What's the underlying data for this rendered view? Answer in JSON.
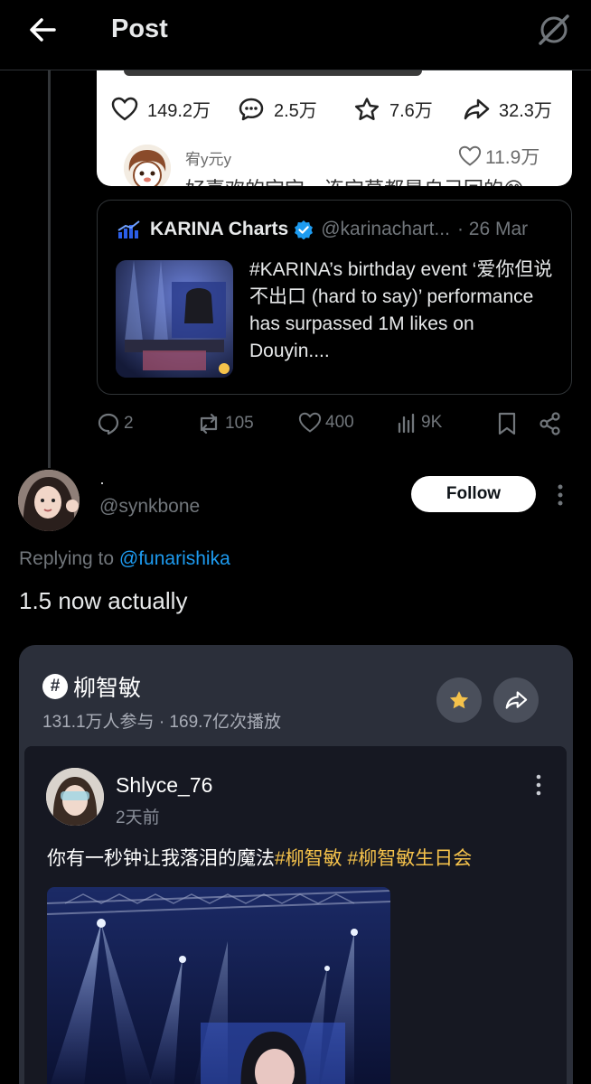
{
  "header": {
    "title": "Post",
    "back_icon": "arrow-left-icon",
    "grok_icon": "grok-icon"
  },
  "embedded_douyin_card": {
    "stats": [
      {
        "icon": "heart-icon",
        "value": "149.2万"
      },
      {
        "icon": "comment-icon",
        "value": "2.5万"
      },
      {
        "icon": "star-icon",
        "value": "7.6万"
      },
      {
        "icon": "share-icon",
        "value": "32.3万"
      }
    ],
    "comment_user": "宥y元y",
    "comment_likes": "11.9万",
    "comment_cut_text": "好喜欢的宝宝，连宝草都是自己回的😊"
  },
  "quote": {
    "name": "KARINA Charts",
    "handle": "@karinachart...",
    "date": "· 26 Mar",
    "text": "#KARINA’s birthday event ‘爱你但说不出口 (hard to say)’ performance has surpassed 1M likes on Douyin...."
  },
  "actions": {
    "replies": "2",
    "reposts": "105",
    "likes": "400",
    "views": "9K"
  },
  "reply": {
    "display_name": "·",
    "handle": "@synkbone",
    "follow_label": "Follow",
    "replying_prefix": "Replying to ",
    "replying_to": "@funarishika",
    "text": "1.5 now actually"
  },
  "douyin_topic": {
    "topic": "柳智敏",
    "meta": "131.1万人参与 · 169.7亿次播放",
    "post_user": "Shlyce_76",
    "post_time": "2天前",
    "post_text": "你有一秒钟让我落泪的魔法",
    "tag1": "#柳智敏",
    "tag2": "#柳智敏生日会"
  },
  "colors": {
    "accent_blue": "#1d9bf0",
    "douyin_tag": "#f5c24b",
    "star_yellow": "#f5c24b"
  }
}
